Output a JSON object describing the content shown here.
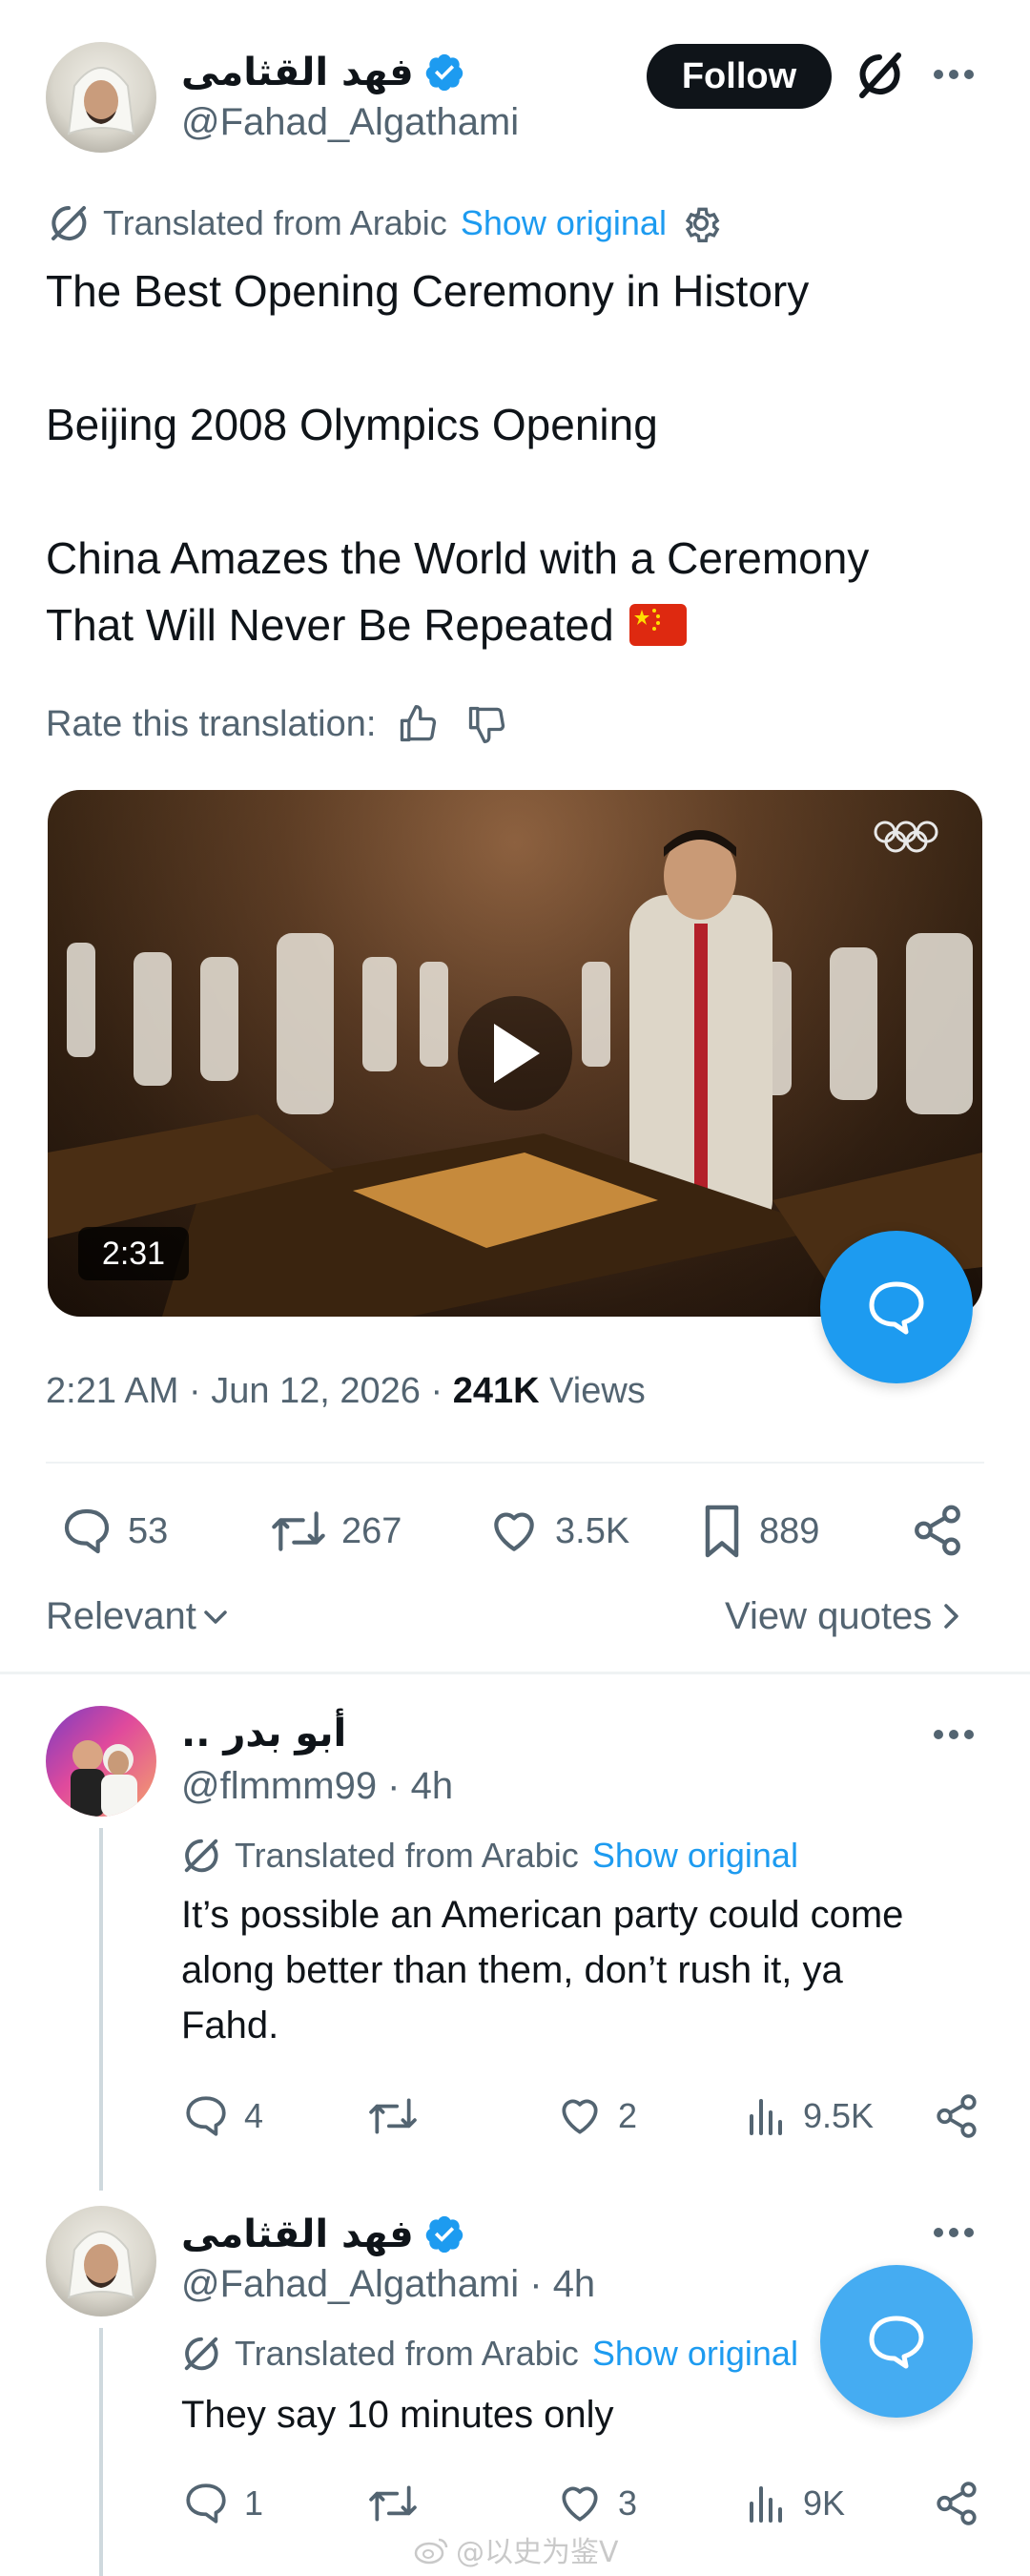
{
  "main_tweet": {
    "author_name": "فهد القثامى",
    "author_handle": "@Fahad_Algathami",
    "follow_label": "Follow",
    "translated_label": "Translated from Arabic",
    "show_original_label": "Show original",
    "text_lines": [
      "The Best Opening Ceremony in History",
      "Beijing 2008 Olympics Opening",
      "China Amazes the World with a Ceremony",
      "That Will Never Be Repeated"
    ],
    "rate_label": "Rate this translation:",
    "video_duration": "2:31",
    "timestamp": "2:21 AM · Jun 12, 2026 · ",
    "views_count": "241K",
    "views_label": " Views",
    "stats": {
      "replies": "53",
      "retweets": "267",
      "likes": "3.5K",
      "bookmarks": "889"
    },
    "sort_label": "Relevant",
    "view_quotes_label": "View quotes"
  },
  "replies": [
    {
      "author_name": ".. أبو بدر",
      "author_handle": "@flmmm99 · 4h",
      "translated_label": "Translated from Arabic",
      "show_original_label": "Show original",
      "text_lines": [
        "It’s possible an American party could come",
        "along better than them, don’t rush it, ya",
        "Fahd."
      ],
      "stats": {
        "replies": "4",
        "retweets": "",
        "likes": "2",
        "views": "9.5K"
      }
    },
    {
      "author_name": "فهد القثامى",
      "author_handle": "@Fahad_Algathami · 4h",
      "translated_label": "Translated from Arabic",
      "show_original_label": "Show original",
      "text_lines": [
        "They say 10 minutes only"
      ],
      "stats": {
        "replies": "1",
        "retweets": "",
        "likes": "3",
        "views": "9K"
      }
    }
  ],
  "watermark": "@以史为鉴V",
  "colors": {
    "accent": "#1d9bf0",
    "text": "#0f1419",
    "muted": "#536471",
    "flag": "#de2910"
  }
}
